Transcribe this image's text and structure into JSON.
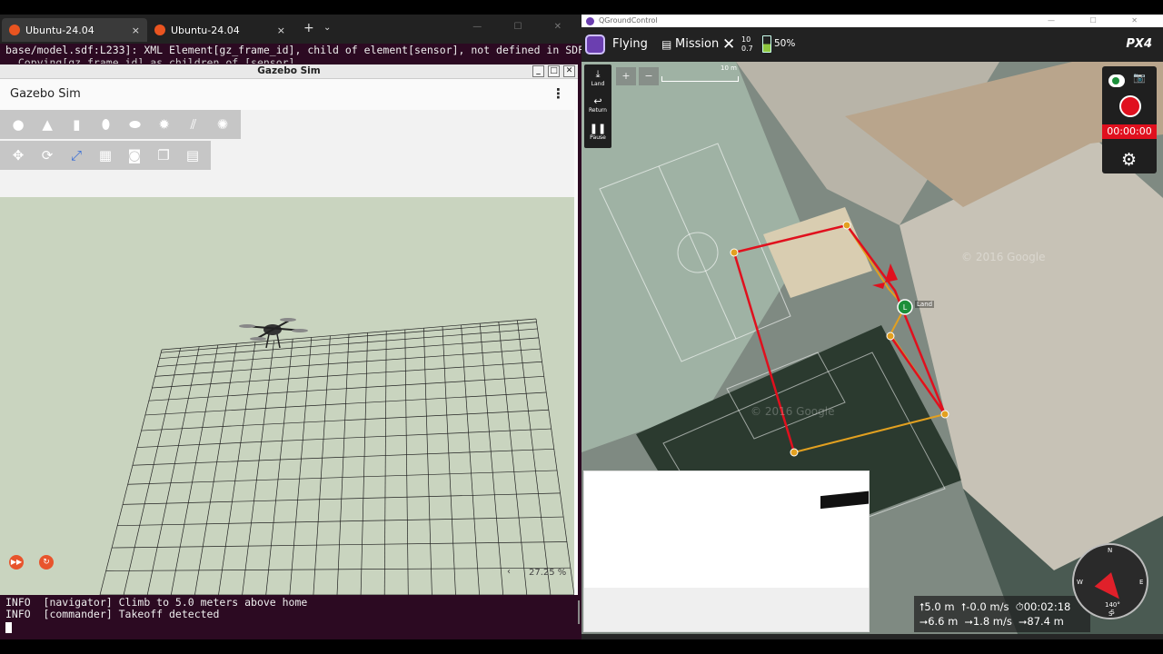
{
  "terminal": {
    "tabs": [
      {
        "label": "Ubuntu-24.04",
        "close": "×"
      },
      {
        "label": "Ubuntu-24.04",
        "close": "×"
      }
    ],
    "new_tab": "+",
    "tab_menu": "⌄",
    "top_line_1": "base/model.sdf:L233]: XML Element[gz_frame_id], child of element[sensor], not defined in SDF",
    "top_line_2": "  Copying[gz_frame_id] as children of [sensor]",
    "bottom_line_1": "INFO  [navigator] Climb to 5.0 meters above home",
    "bottom_line_2": "INFO  [commander] Takeoff detected"
  },
  "gazebo": {
    "window_title": "Gazebo Sim",
    "app_title": "Gazebo Sim",
    "kebab": "⋮",
    "real_time_factor": "27.25 %",
    "rtf_arrow": "‹",
    "shape_tools": [
      "sphere-icon",
      "cone-icon",
      "cylinder-icon",
      "capsule-icon",
      "ellipsoid-icon",
      "sun-icon",
      "directional-light-icon",
      "spot-light-icon"
    ],
    "transform_tools": [
      "translate-icon",
      "rotate-icon",
      "snap-icon",
      "grid-icon",
      "screenshot-icon",
      "copy-icon",
      "paste-icon"
    ]
  },
  "qgc": {
    "os_title": "QGroundControl",
    "flight_mode": "Flying",
    "plan_view": "Mission",
    "satellites": "10",
    "hdop": "0.7",
    "battery": "50%",
    "brand": "PX4",
    "toolstrip": [
      {
        "icon": "land-icon",
        "label": "Land"
      },
      {
        "icon": "return-icon",
        "label": "Return"
      },
      {
        "icon": "pause-icon",
        "label": "Pause"
      }
    ],
    "zoom_in": "+",
    "zoom_out": "−",
    "scale_label": "10 m",
    "record_time": "00:00:00",
    "land_label": "Land",
    "land_marker": "L",
    "map_watermark_1": "© 2016 Google",
    "map_watermark_2": "© 2016 Google",
    "telemetry_line_1": "⭡5.0 m  ⭡-0.0 m/s  ⏱00:02:18",
    "telemetry_line_2": "⭢6.6 m  ⭢1.8 m/s  ⭢87.4 m",
    "compass": {
      "n": "N",
      "e": "E",
      "s": "S",
      "w": "W",
      "heading": "140°",
      "heading_dir": "S"
    },
    "colors": {
      "accent": "#6b3fb0",
      "record": "#e0101e",
      "track": "#e0101e",
      "mission": "#e2a020"
    }
  }
}
